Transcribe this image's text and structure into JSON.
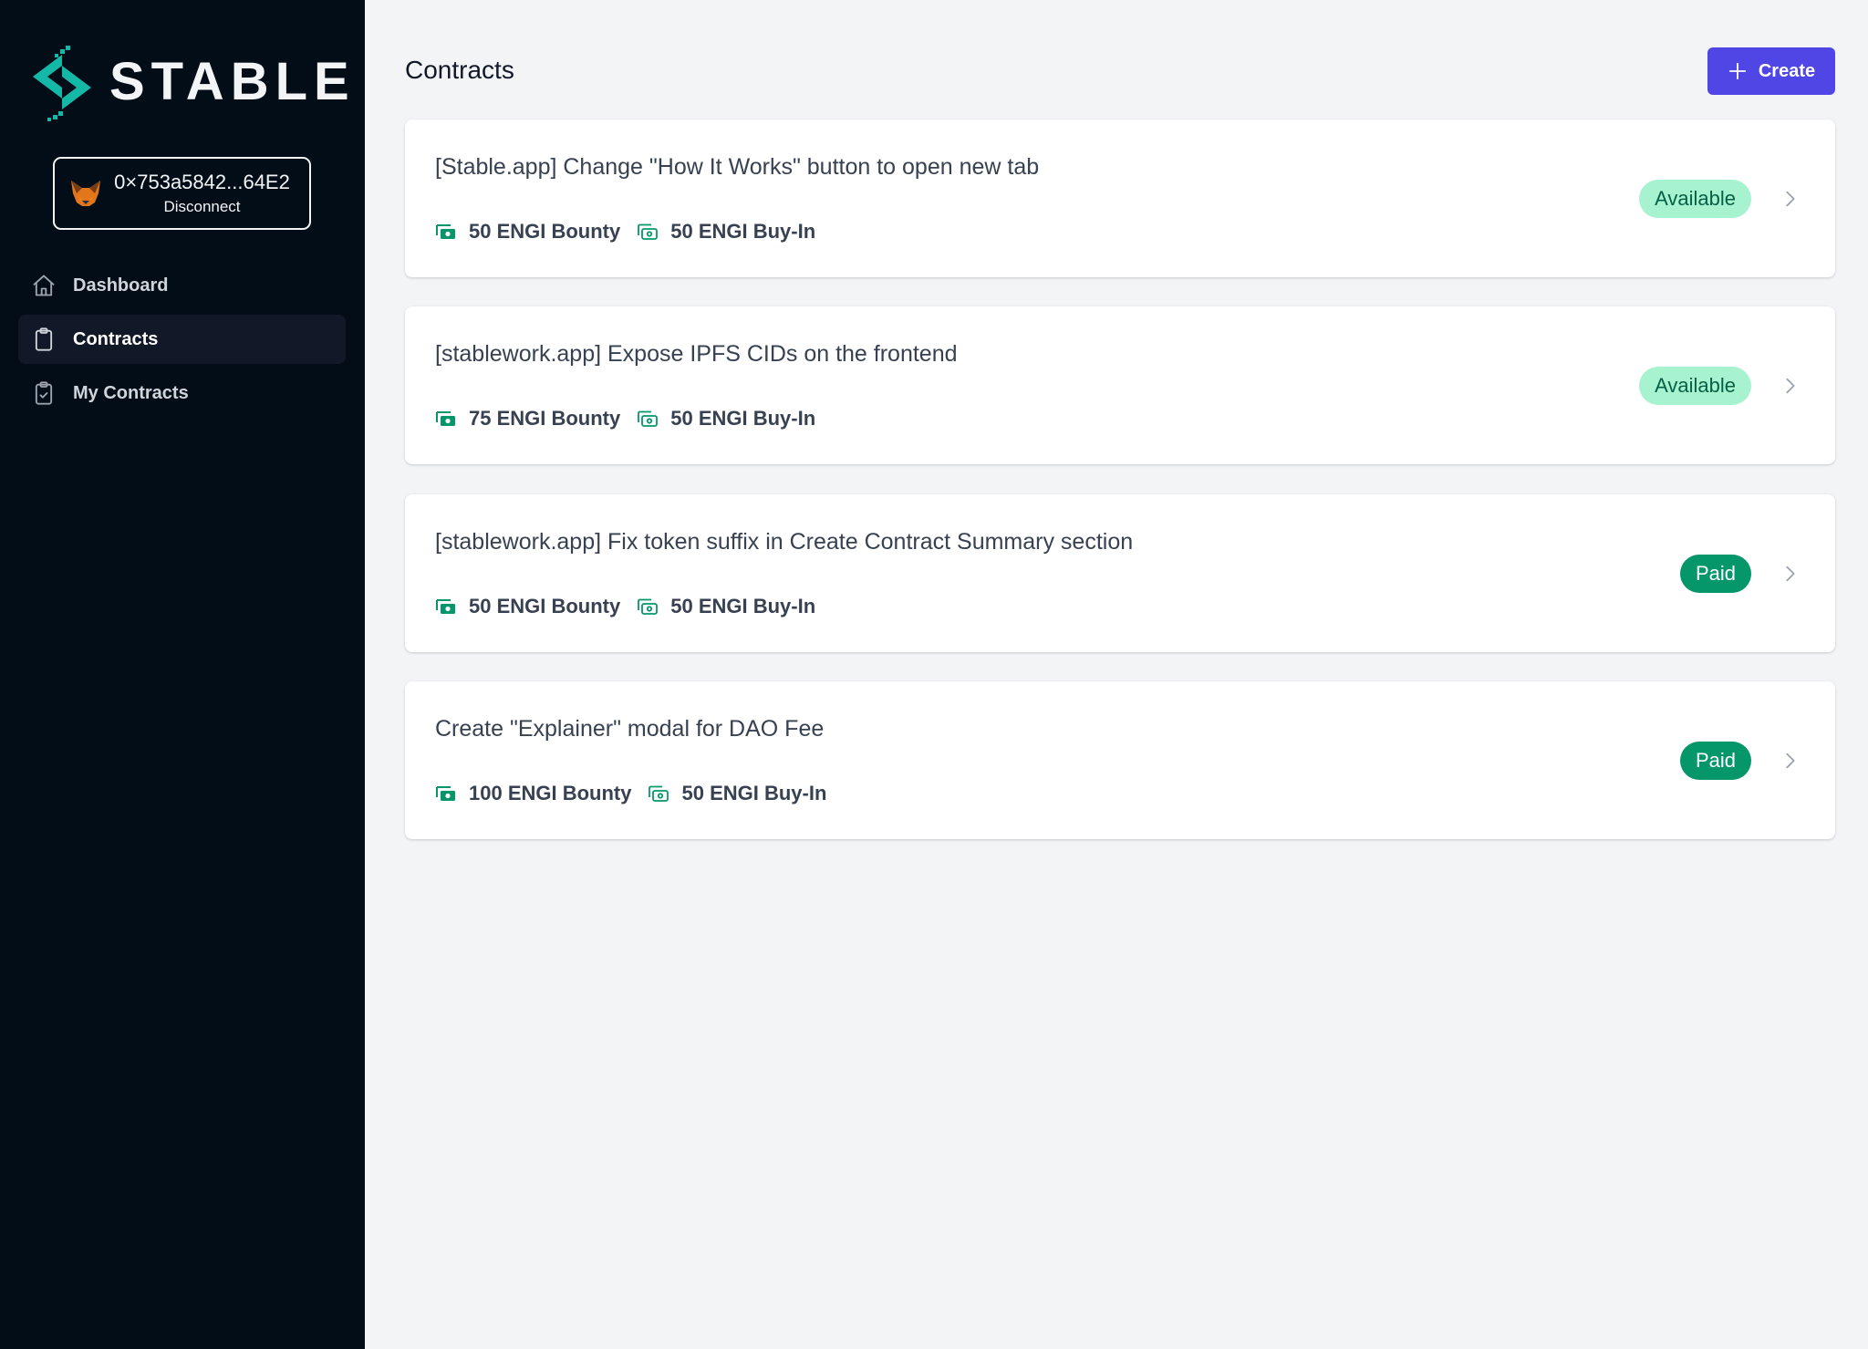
{
  "brand": {
    "name": "STABLE",
    "accent": "#14b8a6"
  },
  "wallet": {
    "address": "0×753a5842...64E2",
    "action": "Disconnect",
    "icon": "metamask-fox-icon"
  },
  "sidebar": {
    "items": [
      {
        "label": "Dashboard",
        "icon": "home-icon",
        "active": false
      },
      {
        "label": "Contracts",
        "icon": "clipboard-icon",
        "active": true
      },
      {
        "label": "My Contracts",
        "icon": "clipboard-check-icon",
        "active": false
      }
    ]
  },
  "header": {
    "title": "Contracts",
    "create_label": "Create",
    "create_color": "#4f46e5"
  },
  "contracts": [
    {
      "title": "[Stable.app] Change \"How It Works\" button to open new tab",
      "bounty": "50 ENGI Bounty",
      "buyin": "50 ENGI Buy-In",
      "status": "Available"
    },
    {
      "title": "[stablework.app] Expose IPFS CIDs on the frontend",
      "bounty": "75 ENGI Bounty",
      "buyin": "50 ENGI Buy-In",
      "status": "Available"
    },
    {
      "title": "[stablework.app] Fix token suffix in Create Contract Summary section",
      "bounty": "50 ENGI Bounty",
      "buyin": "50 ENGI Buy-In",
      "status": "Paid"
    },
    {
      "title": "Create \"Explainer\" modal for DAO Fee",
      "bounty": "100 ENGI Bounty",
      "buyin": "50 ENGI Buy-In",
      "status": "Paid"
    }
  ],
  "status_colors": {
    "available_bg": "#a7f3d0",
    "available_text": "#065f46",
    "paid_bg": "#059669",
    "paid_text": "#ffffff"
  }
}
